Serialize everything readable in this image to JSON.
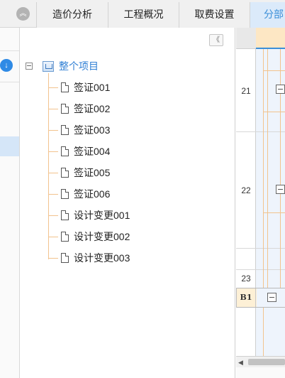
{
  "tabs": [
    {
      "label": "造价分析",
      "active": false
    },
    {
      "label": "工程概况",
      "active": false
    },
    {
      "label": "取费设置",
      "active": false
    },
    {
      "label": "分部",
      "active": true
    }
  ],
  "tree": {
    "root_label": "整个项目",
    "items": [
      {
        "label": "签证001"
      },
      {
        "label": "签证002"
      },
      {
        "label": "签证003"
      },
      {
        "label": "签证004"
      },
      {
        "label": "签证005"
      },
      {
        "label": "签证006"
      },
      {
        "label": "设计变更001"
      },
      {
        "label": "设计变更002"
      },
      {
        "label": "设计变更003"
      }
    ]
  },
  "grid": {
    "rows": [
      {
        "label": "21"
      },
      {
        "label": "22"
      },
      {
        "label": "23"
      }
    ],
    "selected_row_label": "B1"
  },
  "icons": {
    "tab_collapse": "double-chevron-up-icon",
    "panel_collapse": "double-chevron-left-icon",
    "left_action": "download-icon",
    "root_node": "project-folder-icon",
    "tree_item": "document-icon",
    "expand_state": "minus-box-icon"
  },
  "colors": {
    "accent": "#3b8fd8",
    "active_tab_bg": "#dbeafa",
    "tree_connector": "#f2c38e",
    "selected_row_bg": "#fdf0d6"
  }
}
